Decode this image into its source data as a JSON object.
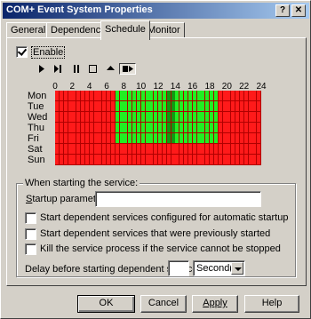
{
  "window": {
    "title": "COM+ Event System Properties",
    "help_button": "?",
    "close_button": "✕"
  },
  "tabs": [
    {
      "label": "General",
      "active": false
    },
    {
      "label": "Dependencies",
      "active": false
    },
    {
      "label": "Schedule",
      "active": true
    },
    {
      "label": "Monitor",
      "active": false
    }
  ],
  "schedule": {
    "enable_label": "Enable",
    "enable_checked": true,
    "toolbar": [
      {
        "name": "play-icon",
        "pressed": false
      },
      {
        "name": "step-icon",
        "pressed": false
      },
      {
        "name": "pause-icon",
        "pressed": false
      },
      {
        "name": "stop-icon",
        "pressed": false
      },
      {
        "name": "eject-icon",
        "pressed": false
      },
      {
        "name": "record-play-icon",
        "pressed": true
      }
    ],
    "hour_ticks": [
      "0",
      "2",
      "4",
      "6",
      "8",
      "10",
      "12",
      "14",
      "16",
      "18",
      "20",
      "22",
      "24"
    ],
    "days": [
      "Mon",
      "Tue",
      "Wed",
      "Thu",
      "Fri",
      "Sat",
      "Sun"
    ],
    "active_days": [
      "Mon",
      "Tue",
      "Wed",
      "Thu",
      "Fri"
    ],
    "active_hours": [
      7,
      19
    ],
    "colors": {
      "inactive": "#ff1a1a",
      "active": "#22ee22",
      "highlight_column": "#119911"
    }
  },
  "service_start": {
    "group_title": "When starting the service:",
    "startup_params_label": "Startup parameters:",
    "startup_params_value": "",
    "options": [
      {
        "label": "Start dependent services configured for automatic startup",
        "checked": false
      },
      {
        "label": "Start dependent services that were previously started",
        "checked": false
      },
      {
        "label": "Kill the service process if the service cannot be stopped",
        "checked": false
      }
    ],
    "delay_label": "Delay before starting dependent services:",
    "delay_value": "",
    "delay_unit": "Second(s)"
  },
  "buttons": {
    "ok": "OK",
    "cancel": "Cancel",
    "apply": "Apply",
    "help": "Help"
  }
}
